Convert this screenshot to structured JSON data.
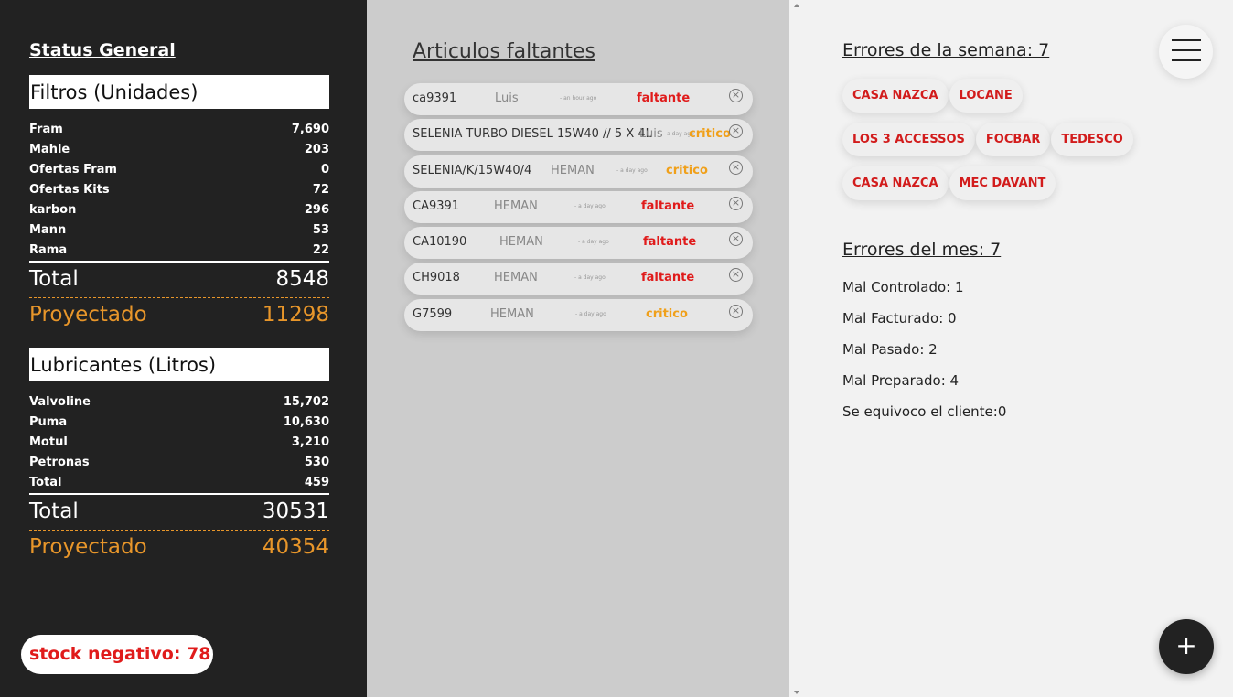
{
  "status": {
    "title": "Status General",
    "filtros": {
      "header": "Filtros (Unidades)",
      "items": [
        {
          "name": "Fram",
          "value": "7,690"
        },
        {
          "name": "Mahle",
          "value": "203"
        },
        {
          "name": "Ofertas Fram",
          "value": "0"
        },
        {
          "name": "Ofertas Kits",
          "value": "72"
        },
        {
          "name": "karbon",
          "value": "296"
        },
        {
          "name": "Mann",
          "value": "53"
        },
        {
          "name": "Rama",
          "value": "22"
        }
      ],
      "total_label": "Total",
      "total_value": "8548",
      "proyectado_label": "Proyectado",
      "proyectado_value": "11298"
    },
    "lubricantes": {
      "header": "Lubricantes (Litros)",
      "items": [
        {
          "name": "Valvoline",
          "value": "15,702"
        },
        {
          "name": "Puma",
          "value": "10,630"
        },
        {
          "name": "Motul",
          "value": "3,210"
        },
        {
          "name": "Petronas",
          "value": "530"
        },
        {
          "name": "Total",
          "value": "459"
        }
      ],
      "total_label": "Total",
      "total_value": "30531",
      "proyectado_label": "Proyectado",
      "proyectado_value": "40354"
    },
    "stock_negativo": "stock negativo: 78"
  },
  "faltantes": {
    "title": "Articulos faltantes",
    "items": [
      {
        "code": "ca9391",
        "who": "Luis",
        "when": "- an hour ago",
        "status": "faltante"
      },
      {
        "code": "SELENIA TURBO DIESEL 15W40 // 5 X 4L",
        "who": "Luis",
        "when": "- a day ago",
        "status": "critico"
      },
      {
        "code": "SELENIA/K/15W40/4",
        "who": "HEMAN",
        "when": "- a day ago",
        "status": "critico"
      },
      {
        "code": "CA9391",
        "who": "HEMAN",
        "when": "- a day ago",
        "status": "faltante"
      },
      {
        "code": "CA10190",
        "who": "HEMAN",
        "when": "- a day ago",
        "status": "faltante"
      },
      {
        "code": "CH9018",
        "who": "HEMAN",
        "when": "- a day ago",
        "status": "faltante"
      },
      {
        "code": "G7599",
        "who": "HEMAN",
        "when": "- a day ago",
        "status": "critico"
      }
    ]
  },
  "errores": {
    "semana_title": "Errores de la semana: 7",
    "semana_chips": [
      "CASA NAZCA",
      "LOCANE",
      "LOS 3 ACCESSOS",
      "FOCBAR",
      "TEDESCO",
      "CASA NAZCA",
      "MEC DAVANT"
    ],
    "mes_title": "Errores del mes: 7",
    "mes_items": [
      "Mal Controlado: 1",
      "Mal Facturado: 0",
      "Mal Pasado: 2",
      "Mal Preparado: 4",
      "Se equivoco el cliente:0"
    ]
  },
  "icons": {
    "menu": "hamburger-menu-icon",
    "add": "plus-icon",
    "close": "close-circle-icon"
  },
  "colors": {
    "dark": "#222222",
    "orange": "#e8962a",
    "red": "#e01b1b",
    "critico": "#f0a01a"
  }
}
